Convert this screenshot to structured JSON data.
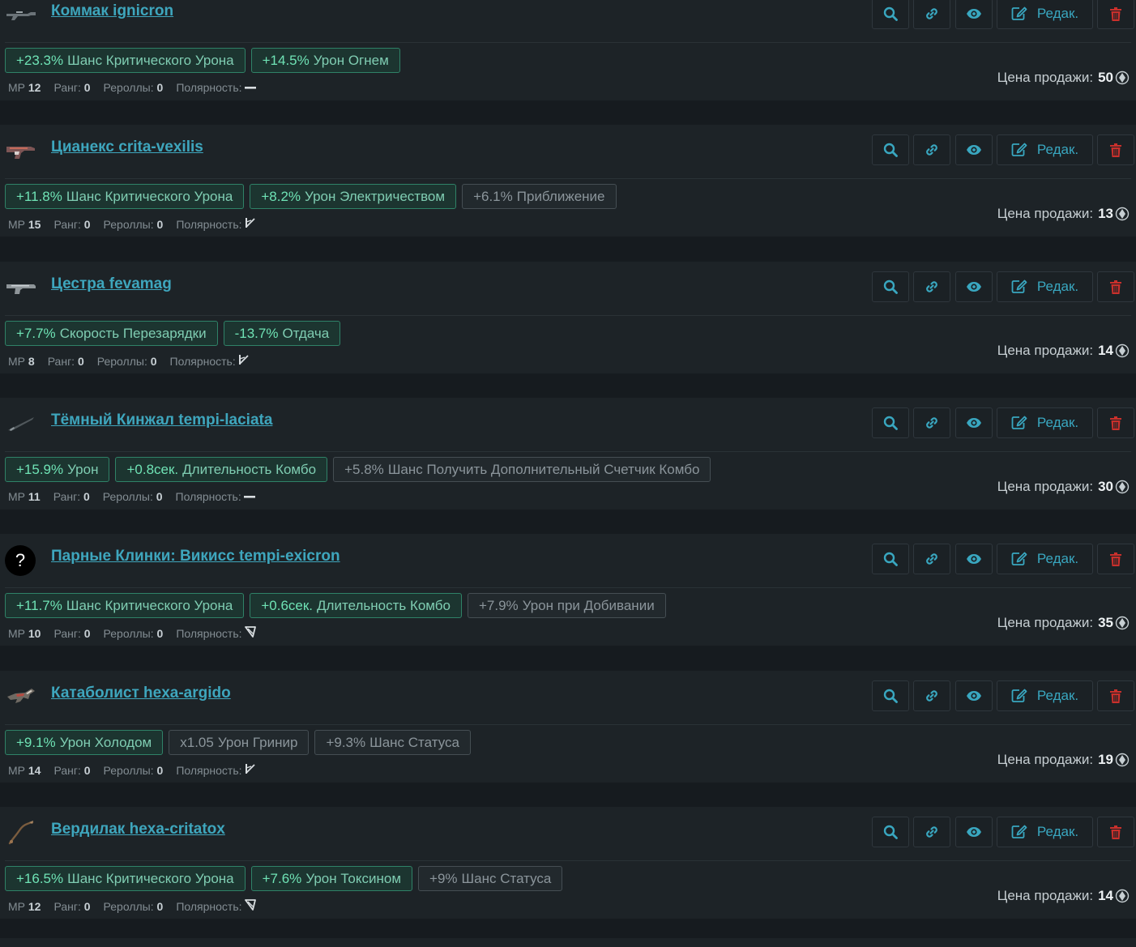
{
  "labels": {
    "mr": "МР",
    "rank": "Ранг:",
    "rerolls": "Рероллы:",
    "polarity": "Полярность:",
    "price": "Цена продажи:",
    "edit": "Редак."
  },
  "colors": {
    "background": "#161b1f",
    "card": "#1d2327",
    "link": "#3ea6bd",
    "positive_tag": "#6fe3b5",
    "neutral_tag": "#8b959b",
    "delete": "#c9302c"
  },
  "items": [
    {
      "title": "Коммак ignicron",
      "thumb": "shotgun-icon",
      "tags": [
        {
          "value": "+23.3%",
          "name": "Шанс Критического Урона",
          "tone": "positive"
        },
        {
          "value": "+14.5%",
          "name": "Урон Огнем",
          "tone": "positive"
        }
      ],
      "mr": "12",
      "rank": "0",
      "rerolls": "0",
      "polarity": "dash",
      "price": "50"
    },
    {
      "title": "Цианекс crita-vexilis",
      "thumb": "pistol-red-icon",
      "tags": [
        {
          "value": "+11.8%",
          "name": "Шанс Критического Урона",
          "tone": "positive"
        },
        {
          "value": "+8.2%",
          "name": "Урон Электричеством",
          "tone": "positive"
        },
        {
          "value": "+6.1%",
          "name": "Приближение",
          "tone": "neutral"
        }
      ],
      "mr": "15",
      "rank": "0",
      "rerolls": "0",
      "polarity": "madurai",
      "price": "13"
    },
    {
      "title": "Цестра fevamag",
      "thumb": "pistol-icon",
      "tags": [
        {
          "value": "+7.7%",
          "name": "Скорость Перезарядки",
          "tone": "positive"
        },
        {
          "value": "-13.7%",
          "name": "Отдача",
          "tone": "positive"
        }
      ],
      "mr": "8",
      "rank": "0",
      "rerolls": "0",
      "polarity": "madurai",
      "price": "14"
    },
    {
      "title": "Тёмный Кинжал tempi-laciata",
      "thumb": "dagger-icon",
      "tags": [
        {
          "value": "+15.9%",
          "name": "Урон",
          "tone": "positive"
        },
        {
          "value": "+0.8сек.",
          "name": "Длительность Комбо",
          "tone": "positive"
        },
        {
          "value": "+5.8%",
          "name": "Шанс Получить Дополнительный Счетчик Комбо",
          "tone": "neutral"
        }
      ],
      "mr": "11",
      "rank": "0",
      "rerolls": "0",
      "polarity": "dash",
      "price": "30"
    },
    {
      "title": "Парные Клинки: Викисс tempi-exicron",
      "thumb": "unknown",
      "thumb_text": "?",
      "tags": [
        {
          "value": "+11.7%",
          "name": "Шанс Критического Урона",
          "tone": "positive"
        },
        {
          "value": "+0.6сек.",
          "name": "Длительность Комбо",
          "tone": "positive"
        },
        {
          "value": "+7.9%",
          "name": "Урон при Добивании",
          "tone": "neutral"
        }
      ],
      "mr": "10",
      "rank": "0",
      "rerolls": "0",
      "polarity": "naramon",
      "price": "35"
    },
    {
      "title": "Катаболист hexa-argido",
      "thumb": "rifle-exotic-icon",
      "tags": [
        {
          "value": "+9.1%",
          "name": "Урон Холодом",
          "tone": "positive"
        },
        {
          "value": "x1.05",
          "name": "Урон Гринир",
          "tone": "neutral"
        },
        {
          "value": "+9.3%",
          "name": "Шанс Статуса",
          "tone": "neutral"
        }
      ],
      "mr": "14",
      "rank": "0",
      "rerolls": "0",
      "polarity": "madurai",
      "price": "19"
    },
    {
      "title": "Вердилак hexa-critatox",
      "thumb": "whip-icon",
      "tags": [
        {
          "value": "+16.5%",
          "name": "Шанс Критического Урона",
          "tone": "positive"
        },
        {
          "value": "+7.6%",
          "name": "Урон Токсином",
          "tone": "positive"
        },
        {
          "value": "+9%",
          "name": "Шанс Статуса",
          "tone": "neutral"
        }
      ],
      "mr": "12",
      "rank": "0",
      "rerolls": "0",
      "polarity": "naramon",
      "price": "14"
    }
  ]
}
